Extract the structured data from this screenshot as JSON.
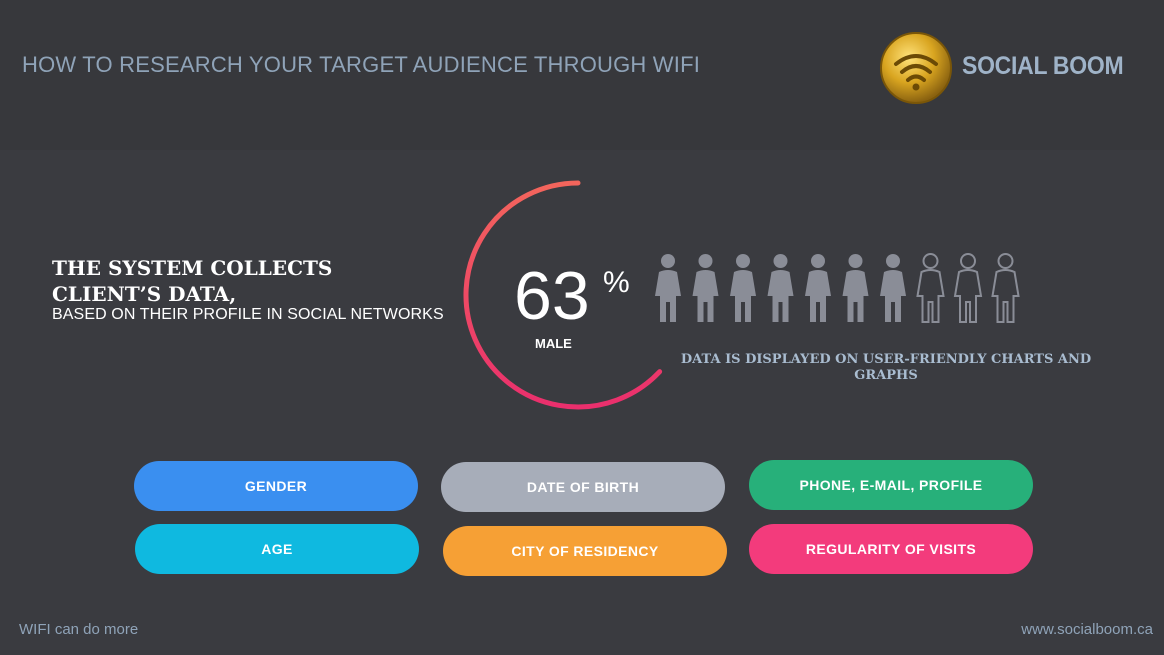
{
  "header": {
    "title": "HOW TO RESEARCH YOUR TARGET AUDIENCE THROUGH WIFI",
    "brand": "SOCIAL BOOM"
  },
  "intro": {
    "title": "THE SYSTEM COLLECTS CLIENT’S DATA,",
    "subtitle": "BASED ON THEIR PROFILE IN SOCIAL NETWORKS"
  },
  "stat": {
    "value": "63",
    "unit": "%",
    "label": "MALE",
    "fraction": 0.63,
    "people_total": 10,
    "people_filled": 7
  },
  "chart_note": "DATA IS DISPLAYED ON USER-FRIENDLY CHARTS AND GRAPHS",
  "data_types": [
    {
      "label": "GENDER",
      "color": "#3a8ff0"
    },
    {
      "label": "DATE OF BIRTH",
      "color": "#a7adb9"
    },
    {
      "label": "PHONE, E-MAIL, PROFILE",
      "color": "#27b07a"
    },
    {
      "label": "AGE",
      "color": "#0fb9e0"
    },
    {
      "label": "CITY OF RESIDENCY",
      "color": "#f6a035"
    },
    {
      "label": "REGULARITY OF VISITS",
      "color": "#f33b7c"
    }
  ],
  "colors": {
    "ring_start": "#f3655c",
    "ring_end": "#ea2f6d",
    "person_filled": "#8a8d97",
    "person_outline": "#8a8d97",
    "logo_gold": "#d9a520"
  },
  "footer": {
    "left": "WIFI can do more",
    "right": "www.socialboom.ca"
  }
}
